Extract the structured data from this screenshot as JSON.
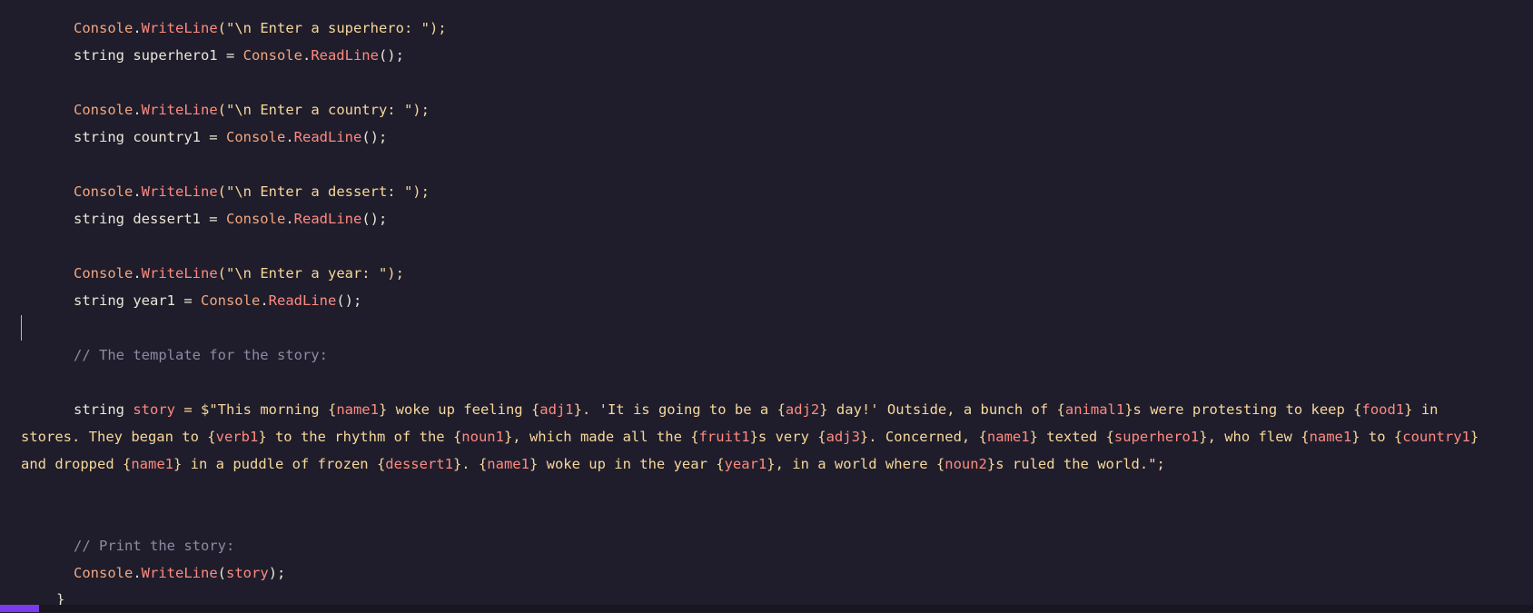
{
  "editor": {
    "lines": [
      {
        "id": "l1",
        "text_parts": [
          [
            "Console",
            "kw"
          ],
          [
            ".",
            "pl"
          ],
          [
            "WriteLine",
            "fn"
          ],
          [
            "(\"\\n Enter a superhero: \");",
            "str"
          ]
        ]
      },
      {
        "id": "l2",
        "text_parts": [
          [
            "string superhero1 = ",
            "pl"
          ],
          [
            "Console",
            "kw"
          ],
          [
            ".",
            "pl"
          ],
          [
            "ReadLine",
            "fn"
          ],
          [
            "();",
            "pl"
          ]
        ]
      },
      {
        "id": "l3",
        "text_parts": [
          [
            "Console",
            "kw"
          ],
          [
            ".",
            "pl"
          ],
          [
            "WriteLine",
            "fn"
          ],
          [
            "(\"\\n Enter a country: \");",
            "str"
          ]
        ]
      },
      {
        "id": "l4",
        "text_parts": [
          [
            "string country1 = ",
            "pl"
          ],
          [
            "Console",
            "kw"
          ],
          [
            ".",
            "pl"
          ],
          [
            "ReadLine",
            "fn"
          ],
          [
            "();",
            "pl"
          ]
        ]
      },
      {
        "id": "l5",
        "text_parts": [
          [
            "Console",
            "kw"
          ],
          [
            ".",
            "pl"
          ],
          [
            "WriteLine",
            "fn"
          ],
          [
            "(\"\\n Enter a dessert: \");",
            "str"
          ]
        ]
      },
      {
        "id": "l6",
        "text_parts": [
          [
            "string dessert1 = ",
            "pl"
          ],
          [
            "Console",
            "kw"
          ],
          [
            ".",
            "pl"
          ],
          [
            "ReadLine",
            "fn"
          ],
          [
            "();",
            "pl"
          ]
        ]
      },
      {
        "id": "l7",
        "text_parts": [
          [
            "Console",
            "kw"
          ],
          [
            ".",
            "pl"
          ],
          [
            "WriteLine",
            "fn"
          ],
          [
            "(\"\\n Enter a year: \");",
            "str"
          ]
        ]
      },
      {
        "id": "l8",
        "text_parts": [
          [
            "string year1 = ",
            "pl"
          ],
          [
            "Console",
            "kw"
          ],
          [
            ".",
            "pl"
          ],
          [
            "ReadLine",
            "fn"
          ],
          [
            "();",
            "pl"
          ]
        ]
      },
      {
        "id": "l9",
        "text_parts": [
          [
            "// The template for the story:",
            "cm"
          ]
        ]
      },
      {
        "id": "l10",
        "text_parts": [
          [
            "string ",
            "pl"
          ],
          [
            "story",
            "var"
          ],
          [
            " = $\"This morning {",
            "str"
          ],
          [
            "name1",
            "var"
          ],
          [
            "} woke up feeling {",
            "str"
          ],
          [
            "adj1",
            "var"
          ],
          [
            "}. 'It is going to be a {",
            "str"
          ],
          [
            "adj2",
            "var"
          ],
          [
            "} day!' Outside, a bunch of {",
            "str"
          ],
          [
            "animal1",
            "var"
          ],
          [
            "}s were protesting to keep {",
            "str"
          ],
          [
            "food1",
            "var"
          ],
          [
            "} in",
            "str"
          ]
        ]
      },
      {
        "id": "l11",
        "text_parts": [
          [
            "stores. They began to {",
            "str"
          ],
          [
            "verb1",
            "var"
          ],
          [
            "} to the rhythm of the {",
            "str"
          ],
          [
            "noun1",
            "var"
          ],
          [
            "}, which made all the {",
            "str"
          ],
          [
            "fruit1",
            "var"
          ],
          [
            "}s very {",
            "str"
          ],
          [
            "adj3",
            "var"
          ],
          [
            "}. Concerned, {",
            "str"
          ],
          [
            "name1",
            "var"
          ],
          [
            "} texted {",
            "str"
          ],
          [
            "superhero1",
            "var"
          ],
          [
            "}, who flew {",
            "str"
          ],
          [
            "name1",
            "var"
          ],
          [
            "} to {",
            "str"
          ],
          [
            "country1",
            "var"
          ],
          [
            "}",
            "str"
          ]
        ]
      },
      {
        "id": "l12",
        "text_parts": [
          [
            "and dropped {",
            "str"
          ],
          [
            "name1",
            "var"
          ],
          [
            "} in a puddle of frozen {",
            "str"
          ],
          [
            "dessert1",
            "var"
          ],
          [
            "}. {",
            "str"
          ],
          [
            "name1",
            "var"
          ],
          [
            "} woke up in the year {",
            "str"
          ],
          [
            "year1",
            "var"
          ],
          [
            "}, in a world where {",
            "str"
          ],
          [
            "noun2",
            "var"
          ],
          [
            "}s ruled the world.\";",
            "str"
          ]
        ]
      },
      {
        "id": "l13",
        "text_parts": [
          [
            "// Print the story:",
            "cm"
          ]
        ]
      },
      {
        "id": "l14",
        "text_parts": [
          [
            "Console",
            "kw"
          ],
          [
            ".",
            "pl"
          ],
          [
            "WriteLine",
            "fn"
          ],
          [
            "(",
            "pl"
          ],
          [
            "story",
            "var"
          ],
          [
            ");",
            "pl"
          ]
        ]
      },
      {
        "id": "l15",
        "text_parts": [
          [
            "}",
            "pl"
          ]
        ]
      }
    ]
  }
}
